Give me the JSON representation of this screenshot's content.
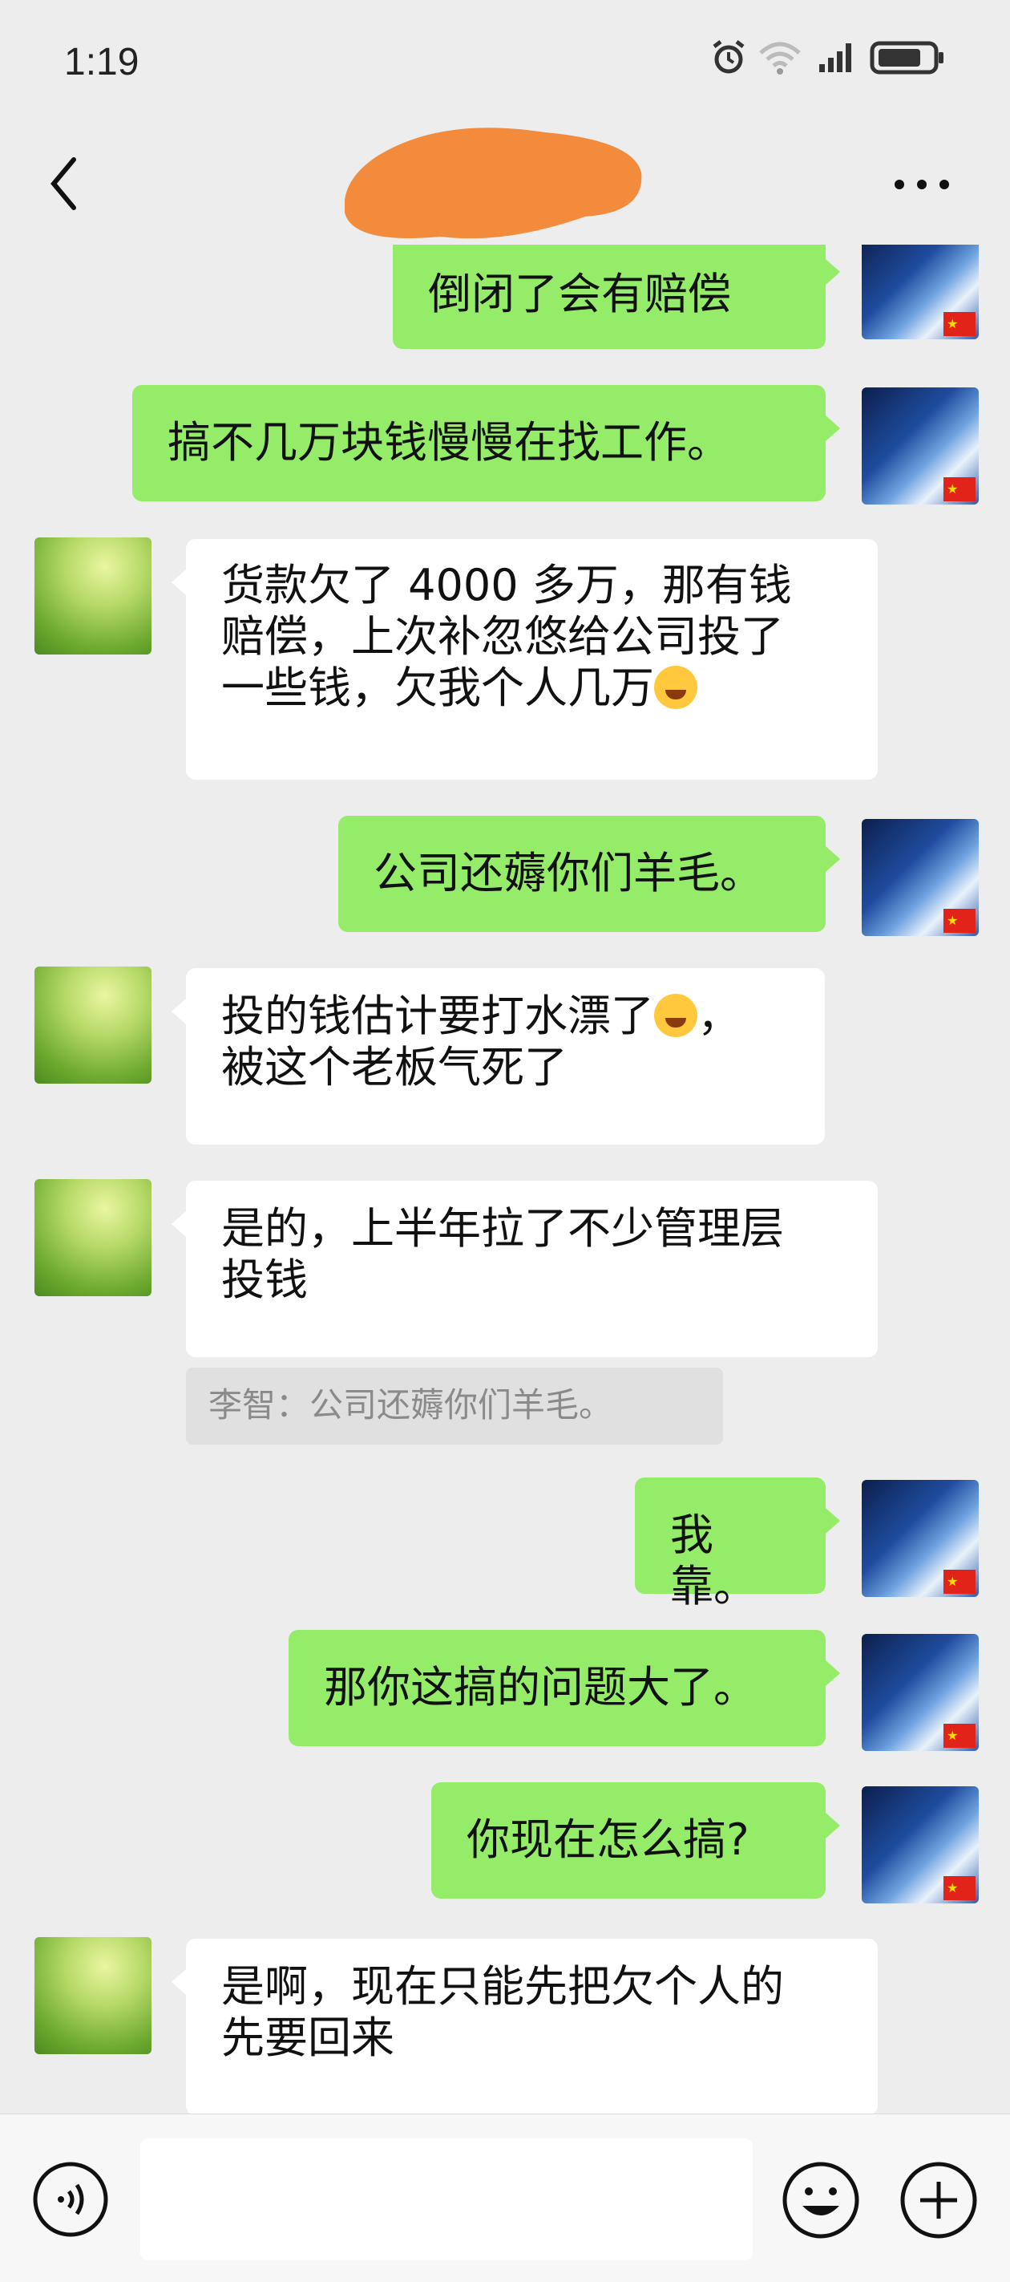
{
  "status_bar": {
    "time": "1:19"
  },
  "header": {
    "title": "",
    "back_icon": "chevron-left-icon",
    "more_icon": "more-dots-icon"
  },
  "messages": [
    {
      "side": "out",
      "text": "倒闭了会有赔偿"
    },
    {
      "side": "out",
      "text": "搞不几万块钱慢慢在找工作。"
    },
    {
      "side": "in",
      "line1": "货款欠了 4000 多万，那有钱",
      "line2": "赔偿，上次补忽悠给公司投了",
      "line3": "一些钱，欠我个人几万"
    },
    {
      "side": "out",
      "text": "公司还薅你们羊毛。"
    },
    {
      "side": "in",
      "line1": "投的钱估计要打水漂了",
      "line1_suffix": "，",
      "line2": "被这个老板气死了"
    },
    {
      "side": "in",
      "line1": "是的，上半年拉了不少管理层",
      "line2": "投钱",
      "quote": "李智：公司还薅你们羊毛。"
    },
    {
      "side": "out",
      "text": "我靠。"
    },
    {
      "side": "out",
      "text": "那你这搞的问题大了。"
    },
    {
      "side": "out",
      "text": "你现在怎么搞?"
    },
    {
      "side": "in",
      "line1": "是啊，现在只能先把欠个人的",
      "line2": "先要回来"
    }
  ],
  "input_bar": {
    "input_value": "",
    "voice_icon": "voice-icon",
    "emoji_icon": "emoji-icon",
    "plus_icon": "plus-icon"
  }
}
